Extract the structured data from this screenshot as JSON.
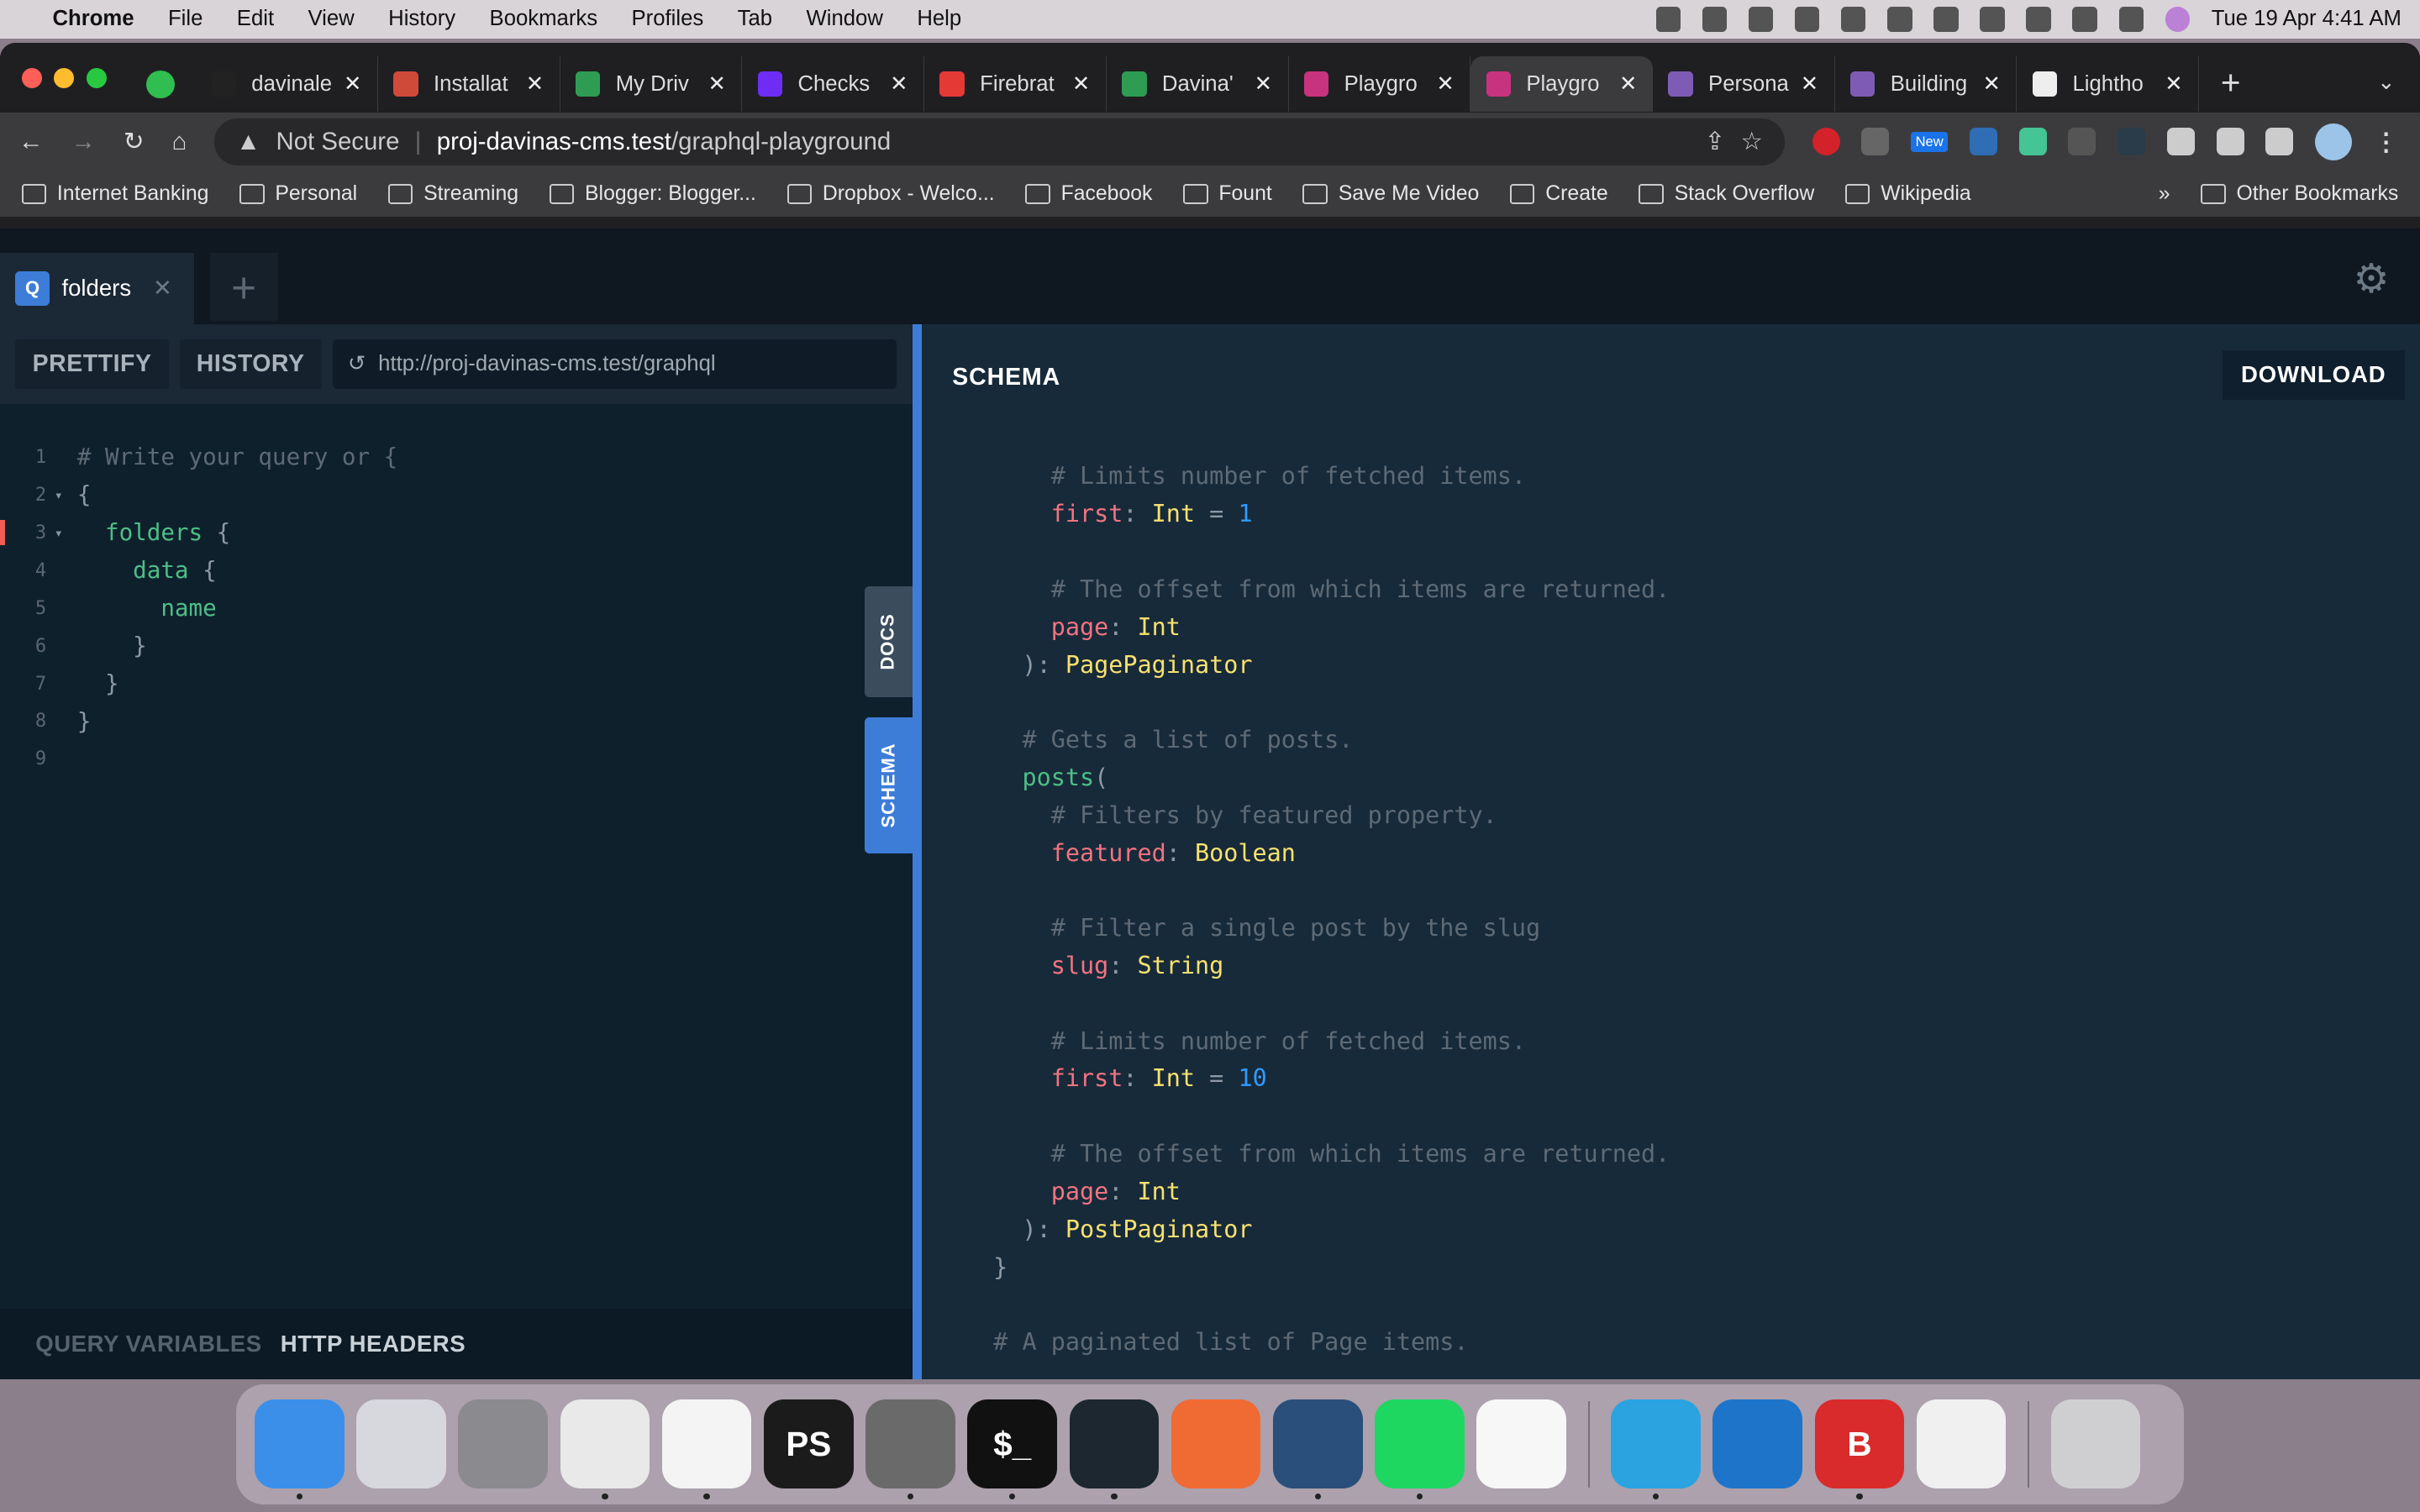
{
  "menubar": {
    "app": "Chrome",
    "items": [
      "File",
      "Edit",
      "View",
      "History",
      "Bookmarks",
      "Profiles",
      "Tab",
      "Window",
      "Help"
    ],
    "clock": "Tue 19 Apr  4:41 AM"
  },
  "browser": {
    "tabs": [
      {
        "title": "davinale",
        "color": "#222"
      },
      {
        "title": "Installat",
        "color": "#d04a3a"
      },
      {
        "title": "My Driv",
        "color": "#2e9d53"
      },
      {
        "title": "Checks",
        "color": "#6f2cf5"
      },
      {
        "title": "Firebrat",
        "color": "#e53935"
      },
      {
        "title": "Davina'",
        "color": "#2e9d53"
      },
      {
        "title": "Playgro",
        "color": "#c7337e"
      },
      {
        "title": "Playgro",
        "color": "#c7337e",
        "active": true
      },
      {
        "title": "Persona",
        "color": "#7e5bb5"
      },
      {
        "title": "Building",
        "color": "#7e5bb5"
      },
      {
        "title": "Lightho",
        "color": "#eeeeee"
      }
    ],
    "security": "Not Secure",
    "url_host": "proj-davinas-cms.test",
    "url_path": "/graphql-playground",
    "ext_new_badge": "New",
    "bookmarks": [
      "Internet Banking",
      "Personal",
      "Streaming",
      "Blogger: Blogger...",
      "Dropbox - Welco...",
      "Facebook",
      "Fount",
      "Save Me Video",
      "Create",
      "Stack Overflow",
      "Wikipedia"
    ],
    "bookmarks_more": "»",
    "other_bookmarks": "Other Bookmarks"
  },
  "playground": {
    "tab": {
      "badge": "Q",
      "name": "folders"
    },
    "prettify": "PRETTIFY",
    "history": "HISTORY",
    "endpoint": "http://proj-davinas-cms.test/graphql",
    "query_lines": [
      {
        "no": "1",
        "fold": "",
        "segs": [
          {
            "t": "# Write your query or {",
            "k": "comment"
          }
        ]
      },
      {
        "no": "2",
        "fold": "▾",
        "segs": [
          {
            "t": "{",
            "k": "punc"
          }
        ]
      },
      {
        "no": "3",
        "fold": "▾",
        "segs": [
          {
            "t": "  folders ",
            "k": "field"
          },
          {
            "t": "{",
            "k": "punc"
          }
        ]
      },
      {
        "no": "4",
        "fold": "",
        "segs": [
          {
            "t": "    data ",
            "k": "field"
          },
          {
            "t": "{",
            "k": "punc"
          }
        ]
      },
      {
        "no": "5",
        "fold": "",
        "segs": [
          {
            "t": "      name",
            "k": "field"
          }
        ]
      },
      {
        "no": "6",
        "fold": "",
        "segs": [
          {
            "t": "    }",
            "k": "punc"
          }
        ]
      },
      {
        "no": "7",
        "fold": "",
        "segs": [
          {
            "t": "  }",
            "k": "punc"
          }
        ]
      },
      {
        "no": "8",
        "fold": "",
        "segs": [
          {
            "t": "}",
            "k": "punc"
          }
        ]
      },
      {
        "no": "9",
        "fold": "",
        "segs": []
      }
    ],
    "query_variables": "QUERY VARIABLES",
    "http_headers": "HTTP HEADERS",
    "docs_tab": "DOCS",
    "schema_tab": "SCHEMA",
    "schema_title": "SCHEMA",
    "download": "DOWNLOAD",
    "schema_lines": [
      [
        {
          "t": "      # Limits number of fetched items.",
          "k": "comment"
        }
      ],
      [
        {
          "t": "      first",
          "k": "key"
        },
        {
          "t": ": ",
          "k": "punc"
        },
        {
          "t": "Int",
          "k": "type"
        },
        {
          "t": " = ",
          "k": "punc"
        },
        {
          "t": "1",
          "k": "num"
        }
      ],
      [],
      [
        {
          "t": "      # The offset from which items are returned.",
          "k": "comment"
        }
      ],
      [
        {
          "t": "      page",
          "k": "key"
        },
        {
          "t": ": ",
          "k": "punc"
        },
        {
          "t": "Int",
          "k": "type"
        }
      ],
      [
        {
          "t": "    ): ",
          "k": "punc"
        },
        {
          "t": "PagePaginator",
          "k": "type"
        }
      ],
      [],
      [
        {
          "t": "    # Gets a list of posts.",
          "k": "comment"
        }
      ],
      [
        {
          "t": "    posts",
          "k": "def"
        },
        {
          "t": "(",
          "k": "punc"
        }
      ],
      [
        {
          "t": "      # Filters by featured property.",
          "k": "comment"
        }
      ],
      [
        {
          "t": "      featured",
          "k": "key"
        },
        {
          "t": ": ",
          "k": "punc"
        },
        {
          "t": "Boolean",
          "k": "type"
        }
      ],
      [],
      [
        {
          "t": "      # Filter a single post by the slug",
          "k": "comment"
        }
      ],
      [
        {
          "t": "      slug",
          "k": "key"
        },
        {
          "t": ": ",
          "k": "punc"
        },
        {
          "t": "String",
          "k": "type"
        }
      ],
      [],
      [
        {
          "t": "      # Limits number of fetched items.",
          "k": "comment"
        }
      ],
      [
        {
          "t": "      first",
          "k": "key"
        },
        {
          "t": ": ",
          "k": "punc"
        },
        {
          "t": "Int",
          "k": "type"
        },
        {
          "t": " = ",
          "k": "punc"
        },
        {
          "t": "10",
          "k": "num"
        }
      ],
      [],
      [
        {
          "t": "      # The offset from which items are returned.",
          "k": "comment"
        }
      ],
      [
        {
          "t": "      page",
          "k": "key"
        },
        {
          "t": ": ",
          "k": "punc"
        },
        {
          "t": "Int",
          "k": "type"
        }
      ],
      [
        {
          "t": "    ): ",
          "k": "punc"
        },
        {
          "t": "PostPaginator",
          "k": "type"
        }
      ],
      [
        {
          "t": "  }",
          "k": "punc"
        }
      ],
      [],
      [
        {
          "t": "  # A paginated list of Page items.",
          "k": "comment"
        }
      ]
    ]
  },
  "dock": [
    {
      "name": "Finder",
      "color": "#3b8fe8",
      "label": "",
      "running": true
    },
    {
      "name": "Launchpad",
      "color": "#d7d7de",
      "label": ""
    },
    {
      "name": "System Preferences",
      "color": "#8a8a8f",
      "label": ""
    },
    {
      "name": "Chrome",
      "color": "#e9e9e9",
      "label": "",
      "running": true
    },
    {
      "name": "VS Code",
      "color": "#f4f4f4",
      "label": "",
      "running": true
    },
    {
      "name": "PhpStorm",
      "color": "#1b1b1b",
      "label": "PS"
    },
    {
      "name": "TablePlus",
      "color": "#6a6a6a",
      "label": "",
      "running": true
    },
    {
      "name": "Terminal",
      "color": "#111",
      "label": "$_",
      "running": true
    },
    {
      "name": "GitKraken",
      "color": "#1d2730",
      "label": "",
      "running": true
    },
    {
      "name": "Postman",
      "color": "#f06a34",
      "label": ""
    },
    {
      "name": "Sequel Pro",
      "color": "#2a4f7a",
      "label": "",
      "running": true
    },
    {
      "name": "Spotify",
      "color": "#1ed760",
      "label": "",
      "running": true
    },
    {
      "name": "Slack",
      "color": "#f7f7f7",
      "label": ""
    },
    {
      "name": "Telegram",
      "color": "#2aa3e0",
      "label": "",
      "running": true
    },
    {
      "name": "Affinity Designer",
      "color": "#1e74c9",
      "label": ""
    },
    {
      "name": "Bear",
      "color": "#d92b2b",
      "label": "B",
      "running": true
    },
    {
      "name": "TextEdit",
      "color": "#f0f0f0",
      "label": ""
    },
    {
      "name": "Trash",
      "color": "#cfcfd2",
      "label": ""
    }
  ]
}
